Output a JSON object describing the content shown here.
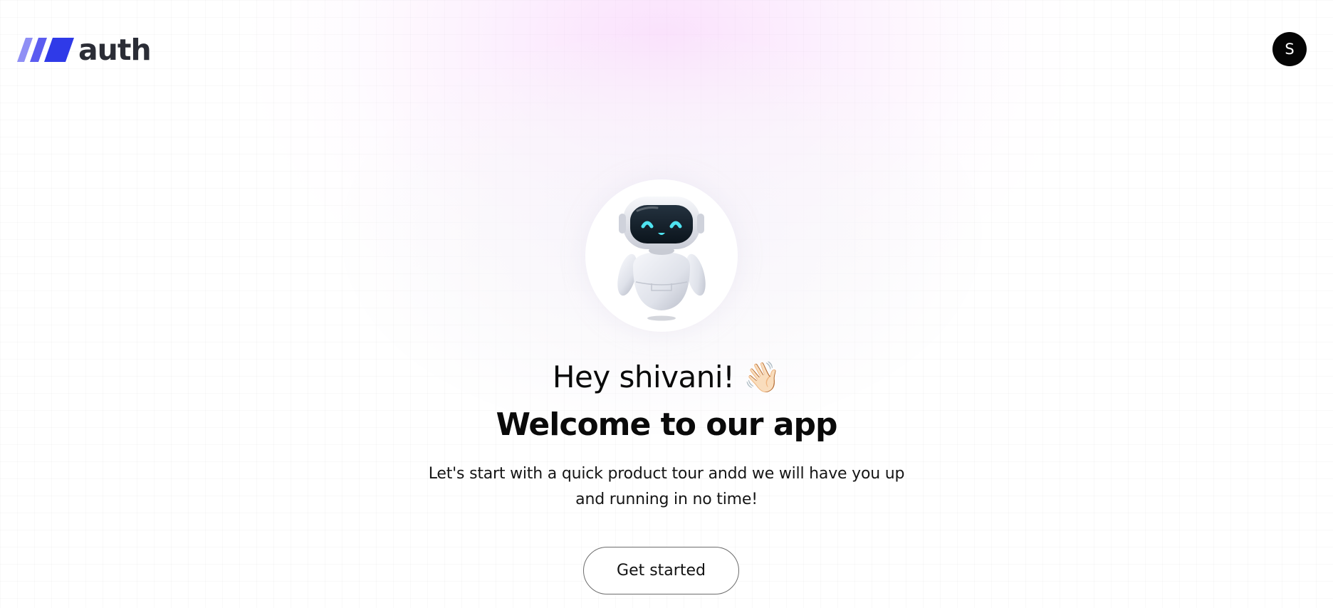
{
  "header": {
    "logo_text": "auth",
    "logo_icon": "slash-stripes-logo",
    "avatar_initial": "S"
  },
  "hero": {
    "illustration": "robot-mascot",
    "greeting": "Hey shivani!",
    "wave_emoji": "👋🏻",
    "title": "Welcome to our app",
    "subtitle": "Let's start with a quick product tour andd we will have you up and running in no time!",
    "cta_label": "Get started"
  },
  "colors": {
    "logo_stripe_light": "#8f8ff5",
    "logo_stripe_mid": "#5b5cf0",
    "logo_stripe_dark": "#2f3ae8",
    "logo_text": "#2b2d36",
    "avatar_bg": "#050505",
    "robot_eye": "#4fe3f0",
    "background_glow": "#f8d7fc"
  }
}
